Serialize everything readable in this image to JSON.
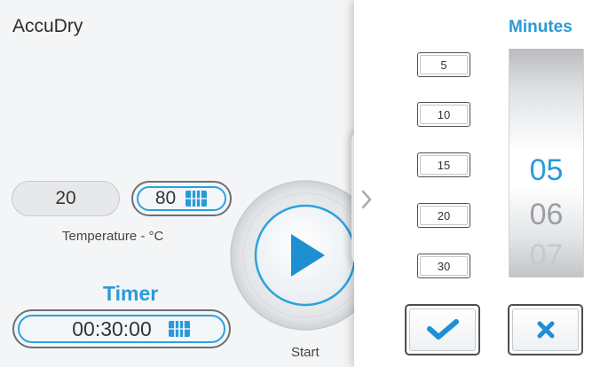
{
  "app": {
    "title": "AccuDry"
  },
  "temperature": {
    "min_value": "20",
    "max_value": "80",
    "label": "Temperature - °C"
  },
  "timer": {
    "label": "Timer",
    "value": "00:30:00"
  },
  "start": {
    "label": "Start"
  },
  "minutes_panel": {
    "title": "Minutes",
    "presets": [
      "5",
      "10",
      "15",
      "20",
      "30"
    ],
    "wheel": {
      "selected": "05",
      "next": "06",
      "next2": "07"
    }
  },
  "icons": {
    "adjust": "adjust-grip-icon",
    "play": "play-icon",
    "chevron": "chevron-right-icon",
    "confirm": "check-icon",
    "cancel": "close-icon"
  },
  "colors": {
    "accent": "#2a9ad8",
    "text": "#333333",
    "panel_bg": "#ffffff",
    "main_bg": "#f4f5f6"
  }
}
